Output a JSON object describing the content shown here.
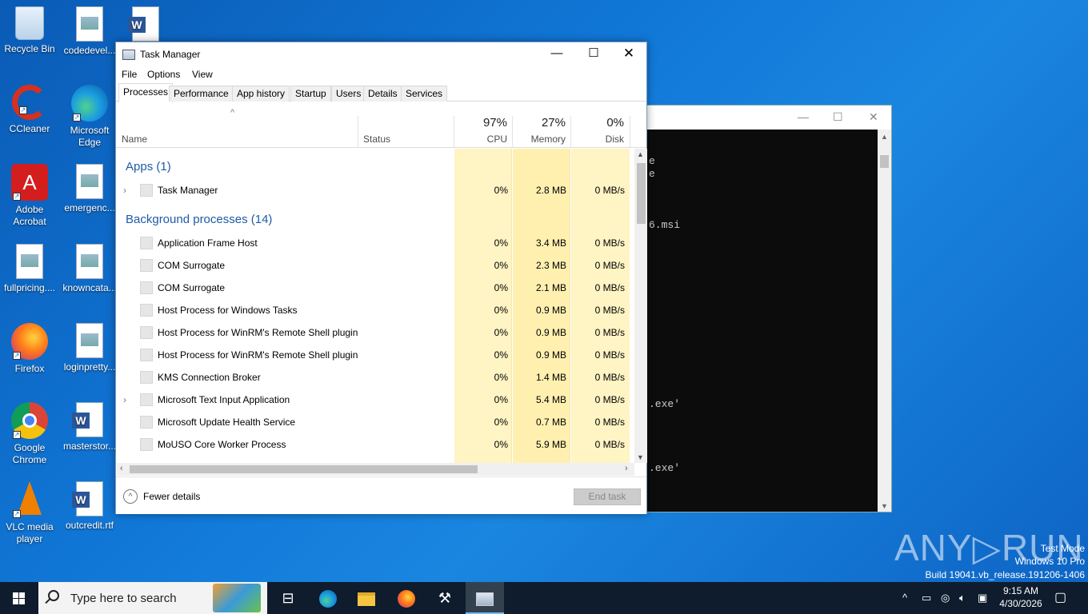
{
  "desktop": {
    "icons": [
      {
        "label": "Recycle Bin"
      },
      {
        "label": "codedevel..."
      },
      {
        "label": "CCleaner"
      },
      {
        "label": "Microsoft Edge"
      },
      {
        "label": "Adobe Acrobat"
      },
      {
        "label": "emergenc..."
      },
      {
        "label": "fullpricing...."
      },
      {
        "label": "knowncata..."
      },
      {
        "label": "Firefox"
      },
      {
        "label": "loginpretty..."
      },
      {
        "label": "Google Chrome"
      },
      {
        "label": "masterstor..."
      },
      {
        "label": "VLC media player"
      },
      {
        "label": "outcredit.rtf"
      }
    ],
    "watermark": {
      "brand": "ANY RUN",
      "line1": "Test Mode",
      "line2": "Windows 10 Pro",
      "line3": "Build 19041.vb_release.191206-1406"
    }
  },
  "console": {
    "lines": [
      "e",
      "e",
      "6.msi",
      ".exe'",
      ".exe'"
    ]
  },
  "task_manager": {
    "title": "Task Manager",
    "menu": [
      "File",
      "Options",
      "View"
    ],
    "tabs": [
      "Processes",
      "Performance",
      "App history",
      "Startup",
      "Users",
      "Details",
      "Services"
    ],
    "active_tab": "Processes",
    "columns": {
      "name": "Name",
      "status": "Status",
      "cpu": {
        "pct": "97%",
        "label": "CPU"
      },
      "memory": {
        "pct": "27%",
        "label": "Memory"
      },
      "disk": {
        "pct": "0%",
        "label": "Disk"
      }
    },
    "groups": {
      "apps": "Apps (1)",
      "background": "Background processes (14)"
    },
    "apps": [
      {
        "name": "Task Manager",
        "cpu": "0%",
        "memory": "2.8 MB",
        "disk": "0 MB/s",
        "expandable": true
      }
    ],
    "background": [
      {
        "name": "Application Frame Host",
        "cpu": "0%",
        "memory": "3.4 MB",
        "disk": "0 MB/s",
        "expandable": false
      },
      {
        "name": "COM Surrogate",
        "cpu": "0%",
        "memory": "2.3 MB",
        "disk": "0 MB/s",
        "expandable": false
      },
      {
        "name": "COM Surrogate",
        "cpu": "0%",
        "memory": "2.1 MB",
        "disk": "0 MB/s",
        "expandable": false
      },
      {
        "name": "Host Process for Windows Tasks",
        "cpu": "0%",
        "memory": "0.9 MB",
        "disk": "0 MB/s",
        "expandable": false
      },
      {
        "name": "Host Process for WinRM's Remote Shell plugin",
        "cpu": "0%",
        "memory": "0.9 MB",
        "disk": "0 MB/s",
        "expandable": false
      },
      {
        "name": "Host Process for WinRM's Remote Shell plugin",
        "cpu": "0%",
        "memory": "0.9 MB",
        "disk": "0 MB/s",
        "expandable": false
      },
      {
        "name": "KMS Connection Broker",
        "cpu": "0%",
        "memory": "1.4 MB",
        "disk": "0 MB/s",
        "expandable": false
      },
      {
        "name": "Microsoft Text Input Application",
        "cpu": "0%",
        "memory": "5.4 MB",
        "disk": "0 MB/s",
        "expandable": true
      },
      {
        "name": "Microsoft Update Health Service",
        "cpu": "0%",
        "memory": "0.7 MB",
        "disk": "0 MB/s",
        "expandable": false
      },
      {
        "name": "MoUSO Core Worker Process",
        "cpu": "0%",
        "memory": "5.9 MB",
        "disk": "0 MB/s",
        "expandable": false
      }
    ],
    "footer": {
      "fewer_details": "Fewer details",
      "end_task": "End task"
    }
  },
  "taskbar": {
    "search_placeholder": "Type here to search",
    "time": "9:15 AM",
    "date": "4/30/2026"
  }
}
